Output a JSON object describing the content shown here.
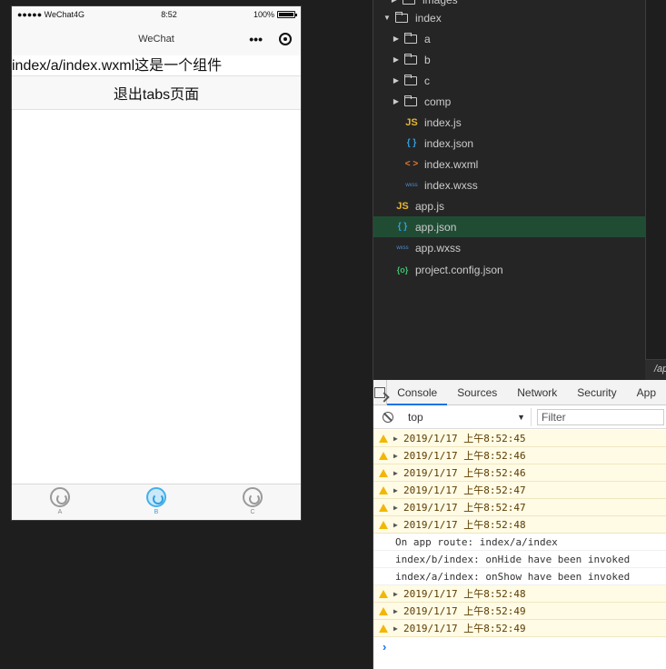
{
  "simulator": {
    "status": {
      "signal": "●●●●● WeChat4G",
      "time": "8:52",
      "battery": "100%"
    },
    "nav": {
      "title": "WeChat",
      "more": "•••"
    },
    "content": {
      "component_text": "index/a/index.wxml这是一个组件",
      "exit_button": "退出tabs页面"
    },
    "tabs": [
      {
        "label": "A",
        "active": false
      },
      {
        "label": "B",
        "active": true
      },
      {
        "label": "C",
        "active": false
      }
    ]
  },
  "explorer": {
    "items": [
      {
        "name": "images",
        "type": "folder",
        "expanded": false
      },
      {
        "name": "index",
        "type": "folder",
        "expanded": true
      },
      {
        "name": "a",
        "type": "folder",
        "expanded": false
      },
      {
        "name": "b",
        "type": "folder",
        "expanded": false
      },
      {
        "name": "c",
        "type": "folder",
        "expanded": false
      },
      {
        "name": "comp",
        "type": "folder",
        "expanded": false
      },
      {
        "name": "index.js",
        "type": "js",
        "icon": "JS"
      },
      {
        "name": "index.json",
        "type": "json",
        "icon": "{ }"
      },
      {
        "name": "index.wxml",
        "type": "wxml",
        "icon": "< >"
      },
      {
        "name": "index.wxss",
        "type": "wxss",
        "icon": "wxss"
      },
      {
        "name": "app.js",
        "type": "js",
        "icon": "JS"
      },
      {
        "name": "app.json",
        "type": "json",
        "icon": "{ }",
        "selected": true
      },
      {
        "name": "app.wxss",
        "type": "wxss",
        "icon": "wxss"
      },
      {
        "name": "project.config.json",
        "type": "config",
        "icon": "{o}"
      }
    ],
    "path_tab": "/ap"
  },
  "devtools": {
    "tabs": [
      "Console",
      "Sources",
      "Network",
      "Security",
      "App"
    ],
    "active_tab": "Console",
    "context": "top",
    "filter_placeholder": "Filter",
    "logs": [
      {
        "level": "warn",
        "text": "2019/1/17 上午8:52:45"
      },
      {
        "level": "warn",
        "text": "2019/1/17 上午8:52:46"
      },
      {
        "level": "warn",
        "text": "2019/1/17 上午8:52:46"
      },
      {
        "level": "warn",
        "text": "2019/1/17 上午8:52:47"
      },
      {
        "level": "warn",
        "text": "2019/1/17 上午8:52:47"
      },
      {
        "level": "warn",
        "text": "2019/1/17 上午8:52:48"
      },
      {
        "level": "info",
        "text": "On app route: index/a/index"
      },
      {
        "level": "info",
        "text": "index/b/index: onHide have been invoked"
      },
      {
        "level": "info",
        "text": "index/a/index: onShow have been invoked"
      },
      {
        "level": "warn",
        "text": "2019/1/17 上午8:52:48"
      },
      {
        "level": "warn",
        "text": "2019/1/17 上午8:52:49"
      },
      {
        "level": "warn",
        "text": "2019/1/17 上午8:52:49"
      }
    ],
    "prompt": "›"
  },
  "colors": {
    "selected_row": "#214c34",
    "active_tab": "#2f9fe0",
    "warn_bg": "#fffbe5"
  }
}
